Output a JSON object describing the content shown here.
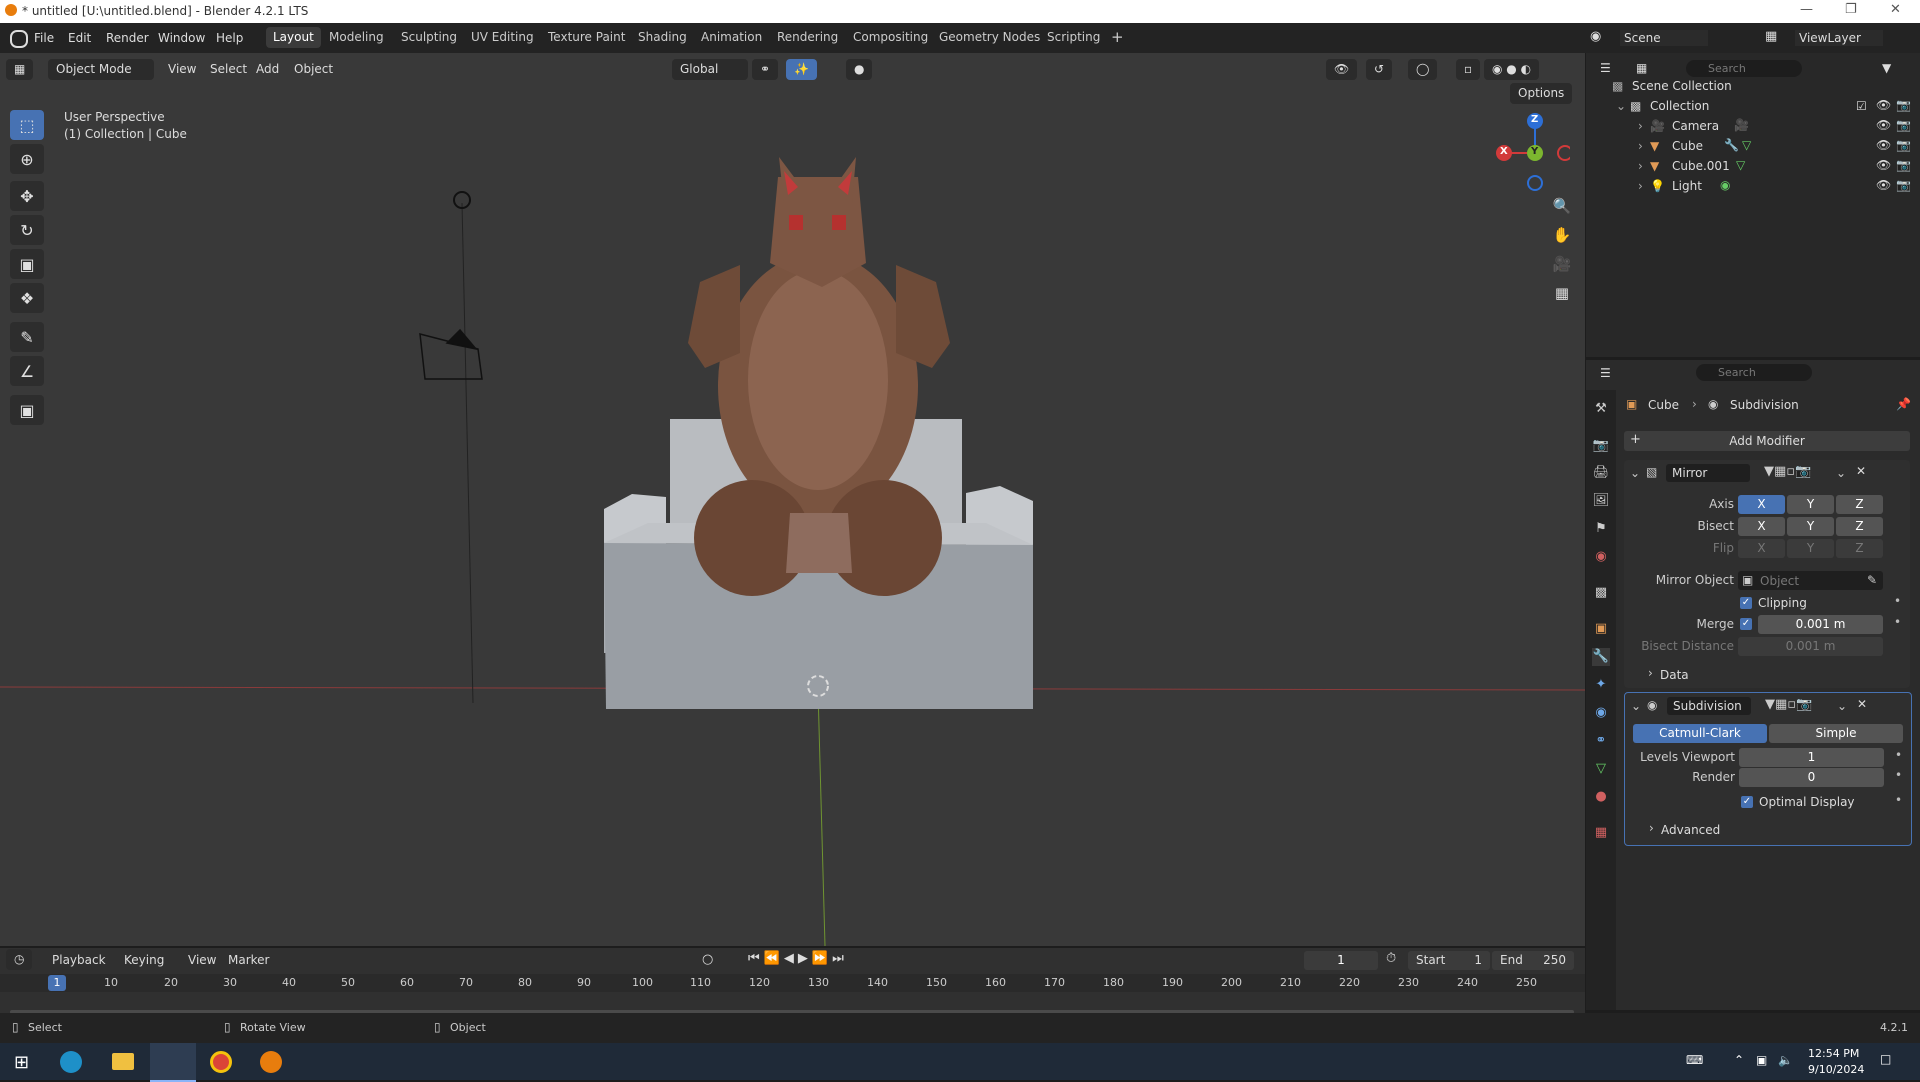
{
  "window": {
    "title": "* untitled [U:\\untitled.blend] - Blender 4.2.1 LTS"
  },
  "menu": [
    "File",
    "Edit",
    "Render",
    "Window",
    "Help"
  ],
  "workspaces": [
    "Layout",
    "Modeling",
    "Sculpting",
    "UV Editing",
    "Texture Paint",
    "Shading",
    "Animation",
    "Rendering",
    "Compositing",
    "Geometry Nodes",
    "Scripting"
  ],
  "header": {
    "scene": "Scene",
    "view_layer": "ViewLayer"
  },
  "viewport": {
    "mode": "Object Mode",
    "menus": [
      "View",
      "Select",
      "Add",
      "Object"
    ],
    "orientation": "Global",
    "options": "Options",
    "overlay_line1": "User Perspective",
    "overlay_line2": "(1) Collection | Cube",
    "gizmo": {
      "x": "X",
      "y": "Y",
      "z": "Z"
    }
  },
  "outliner": {
    "search_placeholder": "Search",
    "scene_collection": "Scene Collection",
    "collection": "Collection",
    "items": [
      "Camera",
      "Cube",
      "Cube.001",
      "Light"
    ]
  },
  "properties": {
    "search_placeholder": "Search",
    "breadcrumb_object": "Cube",
    "breadcrumb_modifier": "Subdivision",
    "add_modifier": "Add Modifier",
    "mirror": {
      "name": "Mirror",
      "axis_label": "Axis",
      "bisect_label": "Bisect",
      "flip_label": "Flip",
      "xyz": [
        "X",
        "Y",
        "Z"
      ],
      "mirror_object_label": "Mirror Object",
      "mirror_object_placeholder": "Object",
      "clipping": "Clipping",
      "merge_label": "Merge",
      "merge_value": "0.001 m",
      "bisect_distance_label": "Bisect Distance",
      "bisect_distance_value": "0.001 m",
      "data_panel": "Data"
    },
    "subdivision": {
      "name": "Subdivision",
      "catmull": "Catmull-Clark",
      "simple": "Simple",
      "levels_viewport_label": "Levels Viewport",
      "levels_viewport": "1",
      "render_label": "Render",
      "render": "0",
      "optimal_display": "Optimal Display",
      "advanced_panel": "Advanced"
    }
  },
  "timeline": {
    "menus": [
      "Playback",
      "Keying",
      "View",
      "Marker"
    ],
    "current_frame": "1",
    "start_label": "Start",
    "start": "1",
    "end_label": "End",
    "end": "250",
    "ticks": [
      "1",
      "10",
      "20",
      "30",
      "40",
      "50",
      "60",
      "70",
      "80",
      "90",
      "100",
      "110",
      "120",
      "130",
      "140",
      "150",
      "160",
      "170",
      "180",
      "190",
      "200",
      "210",
      "220",
      "230",
      "240",
      "250"
    ]
  },
  "statusbar": {
    "select": "Select",
    "rotate": "Rotate View",
    "object": "Object",
    "version": "4.2.1"
  },
  "taskbar": {
    "time": "12:54 PM",
    "date": "9/10/2024"
  }
}
